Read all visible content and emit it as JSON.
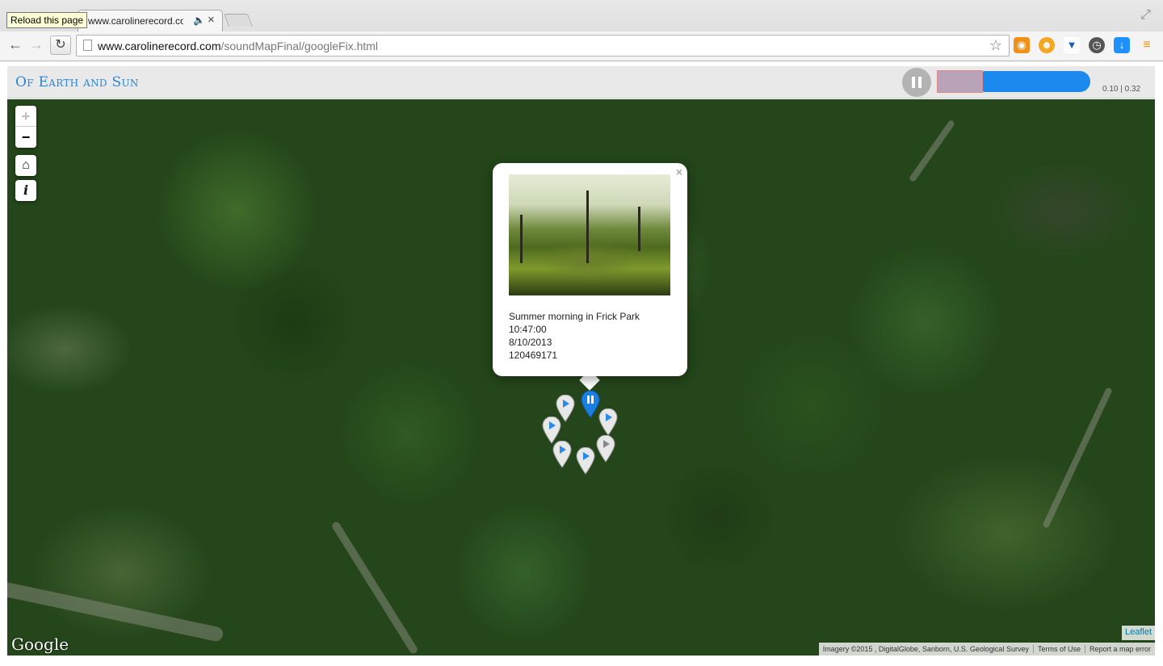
{
  "browser": {
    "tooltip": "Reload this page",
    "tab_title": "www.carolinerecord.com",
    "tab_audio_icon": "speaker-icon",
    "tab_close": "×",
    "url_host": "www.carolinerecord.com",
    "url_path": "/soundMapFinal/googleFix.html"
  },
  "header": {
    "site_title": "Of Earth and Sun",
    "player_time": "0.10 | 0.32",
    "progress_fraction": 0.3125,
    "accent_color": "#1b89ee"
  },
  "map": {
    "zoom_in": "+",
    "zoom_out": "−",
    "home_icon": "home-icon",
    "info_label": "i",
    "popup": {
      "close": "×",
      "title": "Summer morning in Frick Park",
      "time": "10:47:00",
      "date": "8/10/2013",
      "id": "120469171"
    },
    "google_logo": "Google",
    "leaflet_label": "Leaflet",
    "imagery": "Imagery ©2015 , DigitalGlobe, Sanborn, U.S. Geological Survey",
    "terms": "Terms of Use",
    "report": "Report a map error"
  }
}
